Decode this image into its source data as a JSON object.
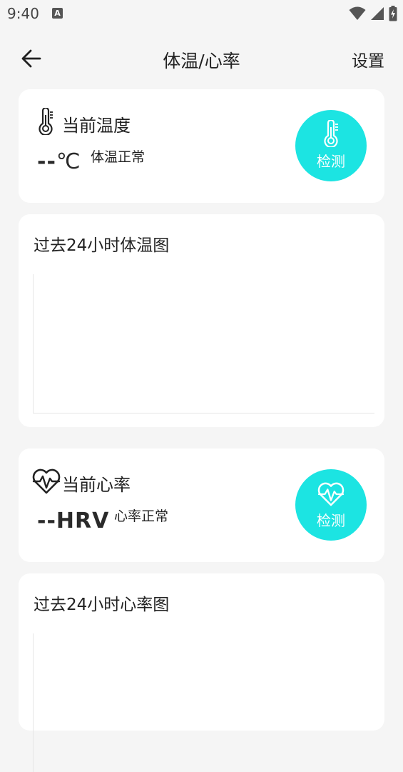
{
  "status_bar": {
    "time": "9:40",
    "notification_icon": "A",
    "icons": [
      "wifi-icon",
      "cell-signal-icon",
      "battery-charging-icon"
    ]
  },
  "app_bar": {
    "title": "体温/心率",
    "back_icon": "arrow-left-icon",
    "settings_label": "设置"
  },
  "temperature": {
    "icon": "thermometer-icon",
    "label": "当前温度",
    "value": "--",
    "unit": "℃",
    "status": "体温正常",
    "detect_label": "检测"
  },
  "temperature_chart": {
    "title": "过去24小时体温图"
  },
  "heart_rate": {
    "icon": "heart-pulse-icon",
    "label": "当前心率",
    "value": "--",
    "unit": "HRV",
    "status": "心率正常",
    "detect_label": "检测"
  },
  "heart_rate_chart": {
    "title": "过去24小时心率图"
  },
  "colors": {
    "accent": "#1ce4e2",
    "background": "#f5f5f5",
    "card": "#ffffff"
  }
}
